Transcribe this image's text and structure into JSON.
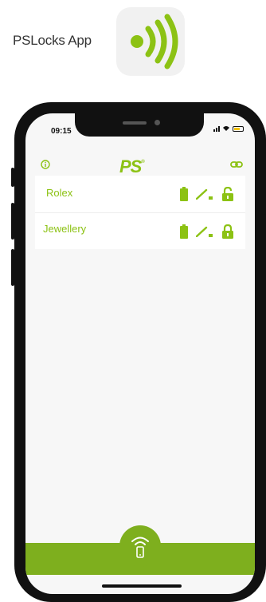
{
  "promo": {
    "label": "PSLocks App",
    "icon": "wifi-signal-icon"
  },
  "status_bar": {
    "time": "09:15"
  },
  "app_header": {
    "logo_text": "PS",
    "logo_mark": "®"
  },
  "locks": [
    {
      "name": "Rolex",
      "lock_state": "unlocked"
    },
    {
      "name": "Jewellery",
      "lock_state": "locked"
    }
  ],
  "colors": {
    "brand_green": "#8cc214",
    "bar_green": "#7eaf1e",
    "battery_yellow": "#f2c300"
  }
}
